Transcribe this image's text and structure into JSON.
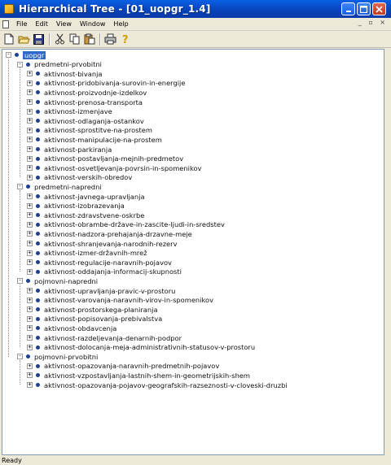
{
  "window": {
    "title": "Hierarchical Tree - [01_uopgr_1.4]"
  },
  "menu": [
    "File",
    "Edit",
    "View",
    "Window",
    "Help"
  ],
  "toolbar_icons": [
    "new-file-icon",
    "open-folder-icon",
    "save-icon",
    "cut-icon",
    "copy-icon",
    "paste-icon",
    "print-icon",
    "help-icon"
  ],
  "tree": {
    "root": "uopgr",
    "groups": [
      {
        "label": "predmetni-prvobitni",
        "children": [
          "aktivnost-bivanja",
          "aktivnost-pridobivanja-surovin-in-energije",
          "aktivnost-proizvodnje-izdelkov",
          "aktivnost-prenosa-transporta",
          "aktivnost-izmenjave",
          "aktivnost-odlaganja-ostankov",
          "aktivnost-sprostitve-na-prostem",
          "aktivnost-manipulacije-na-prostem",
          "aktivnost-parkiranja",
          "aktivnost-postavljanja-mejnih-predmetov",
          "aktivnost-osvetljevanja-povrsin-in-spomenikov",
          "aktivnost-verskih-obredov"
        ]
      },
      {
        "label": "predmetni-napredni",
        "children": [
          "aktivnost-javnega-upravljanja",
          "aktivnost-izobrazevanja",
          "aktivnost-zdravstvene-oskrbe",
          "aktivnost-obrambe-države-in-zascite-ljudi-in-sredstev",
          "aktivnost-nadzora-prehajanja-drzavne-meje",
          "aktivnost-shranjevanja-narodnih-rezerv",
          "aktivnost-izmer-državnih-mrež",
          "aktivnost-regulacije-naravnih-pojavov",
          "aktivnost-oddajanja-informacij-skupnosti"
        ]
      },
      {
        "label": "pojmovni-napredni",
        "children": [
          "aktivnost-upravljanja-pravic-v-prostoru",
          "aktivnost-varovanja-naravnih-virov-in-spomenikov",
          "aktivnost-prostorskega-planiranja",
          "aktivnost-popisovanja-prebivalstva",
          "aktivnost-obdavcenja",
          "aktivnost-razdeljevanja-denarnih-podpor",
          "aktivnost-dolocanja-meja-administrativnih-statusov-v-prostoru"
        ]
      },
      {
        "label": "pojmovni-prvobitni",
        "children": [
          "aktivnost-opazovanja-naravnih-predmetnih-pojavov",
          "aktivnost-vzpostavljanja-lastnih-shem-in-geometrijskih-shem",
          "aktivnost-opazovanja-pojavov-geografskih-razseznosti-v-cloveski-druzbi"
        ]
      }
    ]
  },
  "status": "Ready"
}
